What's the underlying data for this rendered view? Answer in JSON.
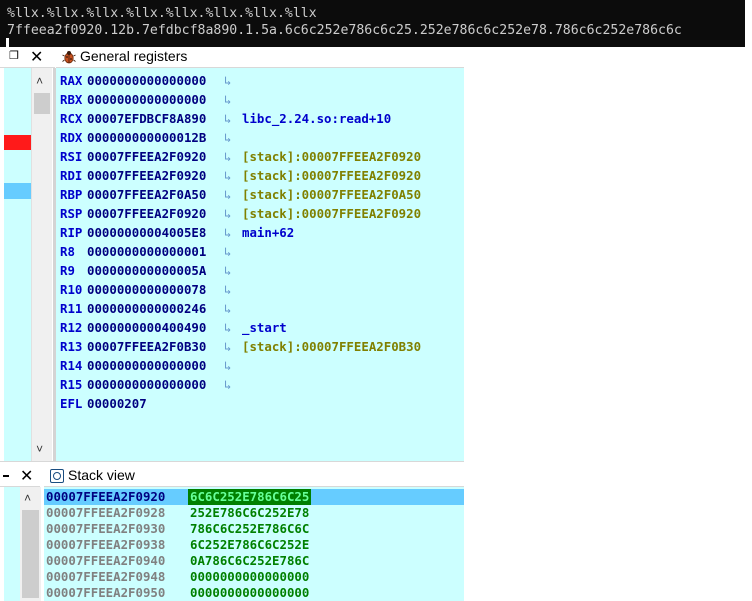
{
  "terminal": {
    "line1": "%llx.%llx.%llx.%llx.%llx.%llx.%llx.%llx",
    "line2": "7ffeea2f0920.12b.7efdbcf8a890.1.5a.6c6c252e786c6c25.252e786c6c252e78.786c6c252e786c6c"
  },
  "left_panel": {
    "restore_glyph": "❐",
    "close_glyph": "✕",
    "scroll_up": "˄",
    "scroll_down": "˅"
  },
  "registers_panel": {
    "title": "General registers",
    "icon": "bug-icon",
    "arrow_glyph": "↳",
    "rows": [
      {
        "name": "RAX",
        "value": "0000000000000000",
        "symbol": "",
        "kind": ""
      },
      {
        "name": "RBX",
        "value": "0000000000000000",
        "symbol": "",
        "kind": ""
      },
      {
        "name": "RCX",
        "value": "00007EFDBCF8A890",
        "symbol": "libc_2.24.so:read+10",
        "kind": "code"
      },
      {
        "name": "RDX",
        "value": "000000000000012B",
        "symbol": "",
        "kind": ""
      },
      {
        "name": "RSI",
        "value": "00007FFEEA2F0920",
        "symbol": "[stack]:00007FFEEA2F0920",
        "kind": "stack"
      },
      {
        "name": "RDI",
        "value": "00007FFEEA2F0920",
        "symbol": "[stack]:00007FFEEA2F0920",
        "kind": "stack"
      },
      {
        "name": "RBP",
        "value": "00007FFEEA2F0A50",
        "symbol": "[stack]:00007FFEEA2F0A50",
        "kind": "stack"
      },
      {
        "name": "RSP",
        "value": "00007FFEEA2F0920",
        "symbol": "[stack]:00007FFEEA2F0920",
        "kind": "stack"
      },
      {
        "name": "RIP",
        "value": "00000000004005E8",
        "symbol": "main+62",
        "kind": "code"
      },
      {
        "name": "R8",
        "value": "0000000000000001",
        "symbol": "",
        "kind": ""
      },
      {
        "name": "R9",
        "value": "000000000000005A",
        "symbol": "",
        "kind": ""
      },
      {
        "name": "R10",
        "value": "0000000000000078",
        "symbol": "",
        "kind": ""
      },
      {
        "name": "R11",
        "value": "0000000000000246",
        "symbol": "",
        "kind": ""
      },
      {
        "name": "R12",
        "value": "0000000000400490",
        "symbol": "_start",
        "kind": "code"
      },
      {
        "name": "R13",
        "value": "00007FFEEA2F0B30",
        "symbol": "[stack]:00007FFEEA2F0B30",
        "kind": "stack"
      },
      {
        "name": "R14",
        "value": "0000000000000000",
        "symbol": "",
        "kind": ""
      },
      {
        "name": "R15",
        "value": "0000000000000000",
        "symbol": "",
        "kind": ""
      },
      {
        "name": "EFL",
        "value": "00000207",
        "symbol": "",
        "kind": "noarrow"
      }
    ]
  },
  "bottom_left": {
    "close_glyph": "✕",
    "scroll_up": "˄"
  },
  "stack_panel": {
    "title": "Stack view",
    "icon": "stack-view-icon",
    "rows": [
      {
        "addr": "00007FFEEA2F0920",
        "value": "6C6C252E786C6C25",
        "selected": true
      },
      {
        "addr": "00007FFEEA2F0928",
        "value": "252E786C6C252E78",
        "selected": false
      },
      {
        "addr": "00007FFEEA2F0930",
        "value": "786C6C252E786C6C",
        "selected": false
      },
      {
        "addr": "00007FFEEA2F0938",
        "value": "6C252E786C6C252E",
        "selected": false
      },
      {
        "addr": "00007FFEEA2F0940",
        "value": "0A786C6C252E786C",
        "selected": false
      },
      {
        "addr": "00007FFEEA2F0948",
        "value": "0000000000000000",
        "selected": false
      },
      {
        "addr": "00007FFEEA2F0950",
        "value": "0000000000000000",
        "selected": false
      }
    ]
  }
}
